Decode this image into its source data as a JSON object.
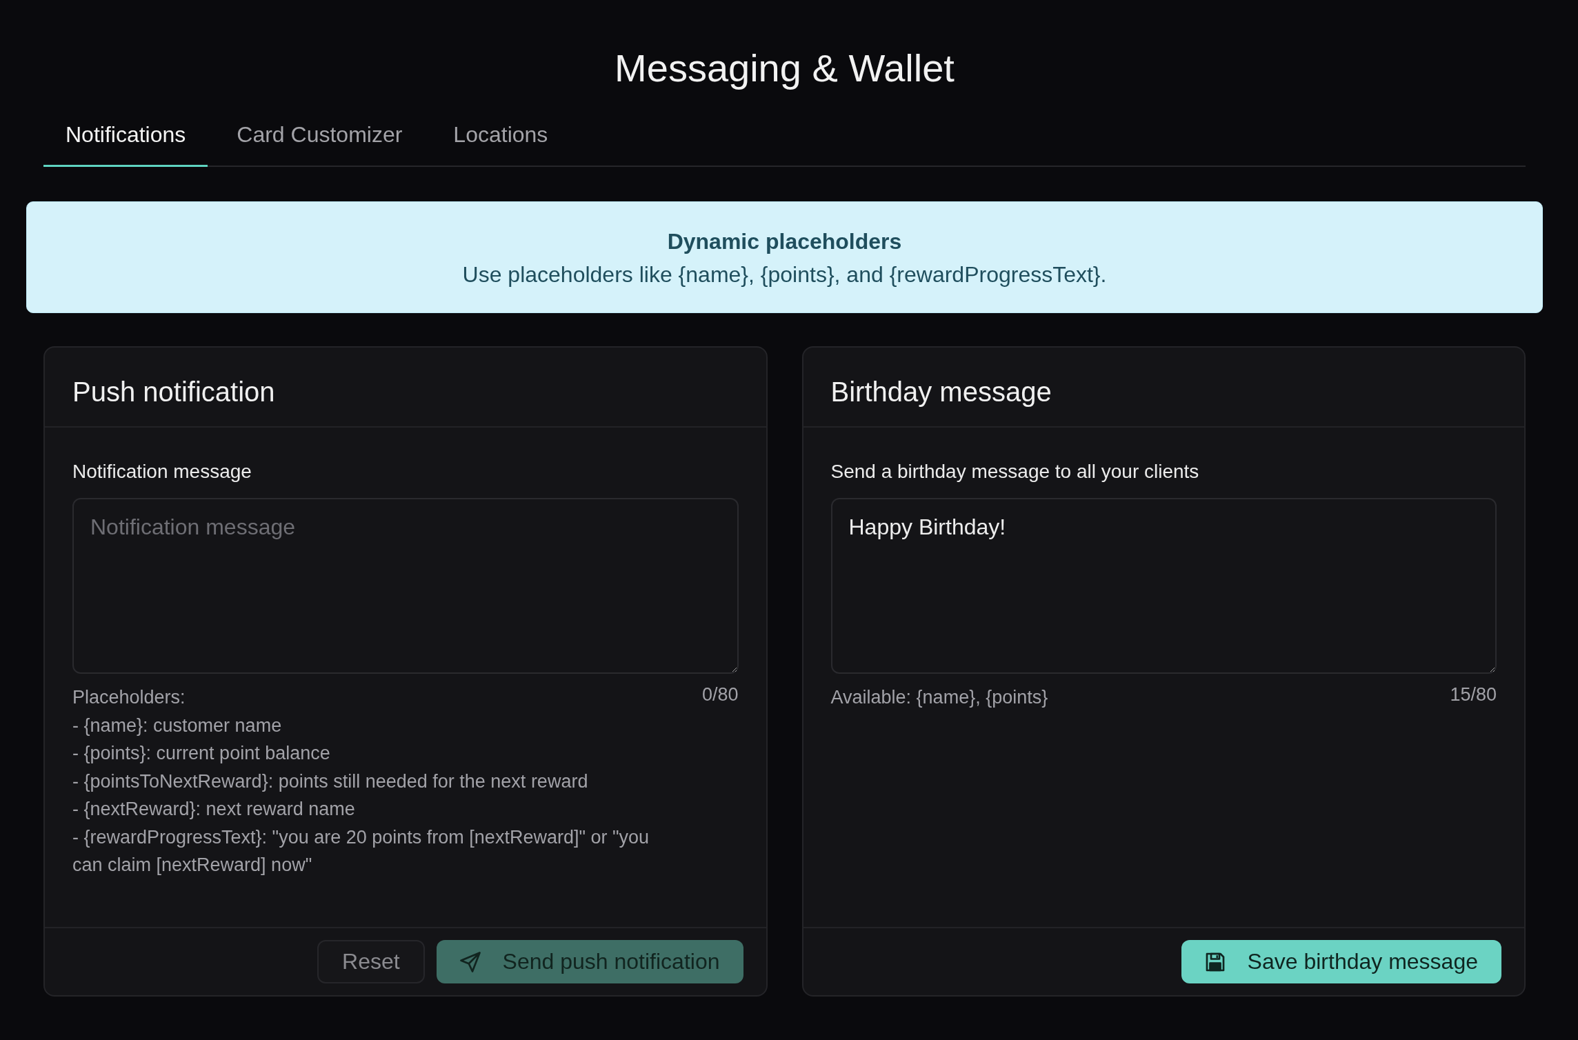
{
  "header": {
    "title": "Messaging & Wallet"
  },
  "tabs": [
    {
      "label": "Notifications",
      "selected": true
    },
    {
      "label": "Card Customizer",
      "selected": false
    },
    {
      "label": "Locations",
      "selected": false
    }
  ],
  "banner": {
    "title": "Dynamic placeholders",
    "text": "Use placeholders like {name}, {points}, and {rewardProgressText}."
  },
  "cards": [
    {
      "title": "Push notification",
      "field": {
        "label": "Notification message",
        "placeholder": "Notification message",
        "counter": "0/80"
      },
      "help_lines": [
        "Placeholders:",
        "- {name}: customer name",
        "- {points}: current point balance",
        "- {pointsToNextReward}: points still needed for the next reward",
        "- {nextReward}: next reward name",
        "- {rewardProgressText}: \"you are 20 points from [nextReward]\" or \"you can claim [nextReward] now\""
      ],
      "buttons": [
        {
          "kind": "reset",
          "label": "Reset",
          "disabled": true
        },
        {
          "kind": "send",
          "label": "Send push notification",
          "disabled": true
        }
      ]
    },
    {
      "title": "Birthday message",
      "field": {
        "label": "Send a birthday message to all your clients",
        "value": "Happy Birthday!",
        "counter": "15/80"
      },
      "help_lines": [
        "Available: {name}, {points}"
      ],
      "buttons": [
        {
          "kind": "save",
          "label": "Save birthday message",
          "disabled": false
        }
      ]
    }
  ]
}
